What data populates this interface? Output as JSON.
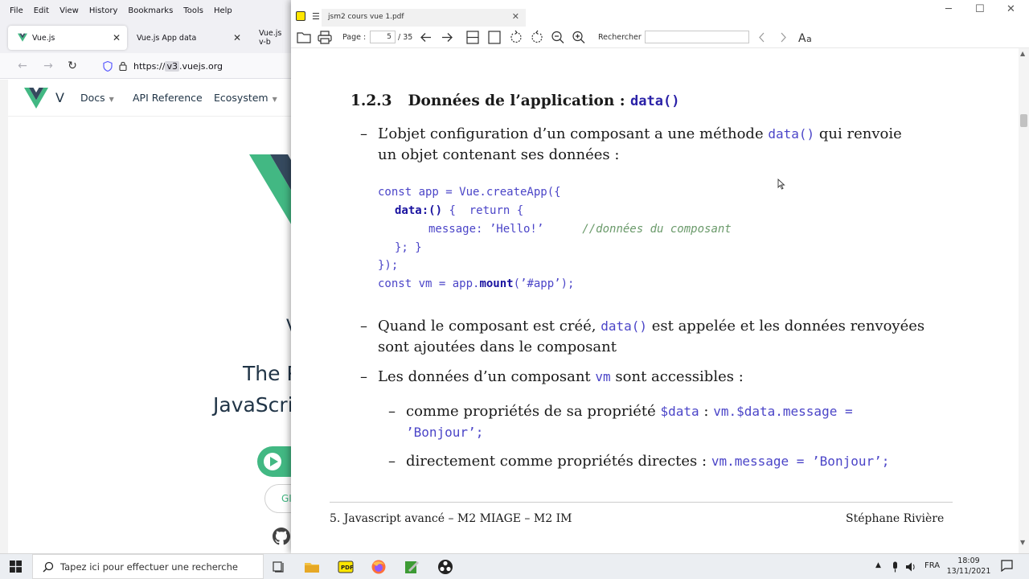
{
  "browser": {
    "menu": [
      "File",
      "Edit",
      "View",
      "History",
      "Bookmarks",
      "Tools",
      "Help"
    ],
    "tabs": [
      {
        "title": "Vue.js"
      },
      {
        "title": "Vue.js App data"
      },
      {
        "title": "Vue.js v-b"
      }
    ],
    "url": {
      "prefix": "https://",
      "masked": "v3",
      "suffix": ".vuejs.org"
    },
    "site": {
      "logo_text": "V",
      "nav": [
        "Docs",
        "API Reference",
        "Ecosystem"
      ],
      "hero_line1": "The P",
      "hero_line2": "JavaScri",
      "v_fragment": "V",
      "button_gi": "GI"
    },
    "accent_color": "#42b883"
  },
  "pdf_viewer": {
    "tab_title": "jsm2 cours vue 1.pdf",
    "toolbar": {
      "page_label": "Page :",
      "page_current": "5",
      "page_total": "/ 35",
      "search_label": "Rechercher :",
      "search_value": ""
    },
    "document": {
      "section_number": "1.2.3",
      "section_title": "Données de l’application :",
      "section_code": "data()",
      "bullet1_pre": "L’objet configuration d’un composant a une méthode",
      "bullet1_code": "data()",
      "bullet1_post": "qui renvoie",
      "bullet1_line2": "un objet contenant ses données :",
      "code_lines": {
        "l1a": "const app = Vue.createApp({",
        "l2a": "data:()",
        "l2b": " {  return {",
        "l3a": "message: ’Hello!’",
        "l3b": "//données du composant",
        "l4": "}; }",
        "l5": "});",
        "l6a": "const vm = app.",
        "l6b": "mount",
        "l6c": "(’#app’);"
      },
      "bullet2_pre": "Quand le composant est créé,",
      "bullet2_code": "data()",
      "bullet2_post": "est appelée et les données renvoyées",
      "bullet2_line2": "sont ajoutées dans le composant",
      "bullet3_pre": "Les données d’un composant",
      "bullet3_code": "vm",
      "bullet3_post": "sont accessibles :",
      "sub1_pre": "comme propriétés de sa propriété",
      "sub1_code1": "$data",
      "sub1_colon": ":",
      "sub1_code2": "vm.$data.message =",
      "sub1_line2": "’Bonjour’;",
      "sub2_pre": "directement comme propriétés directes :",
      "sub2_code": "vm.message = ’Bonjour’;",
      "dash": "–",
      "footer_left": "5.   Javascript avancé – M2 MIAGE – M2 IM",
      "footer_right": "Stéphane Rivière"
    }
  },
  "taskbar": {
    "search_placeholder": "Tapez ici pour effectuer une recherche",
    "language": "FRA",
    "time": "18:09",
    "date": "13/11/2021"
  }
}
